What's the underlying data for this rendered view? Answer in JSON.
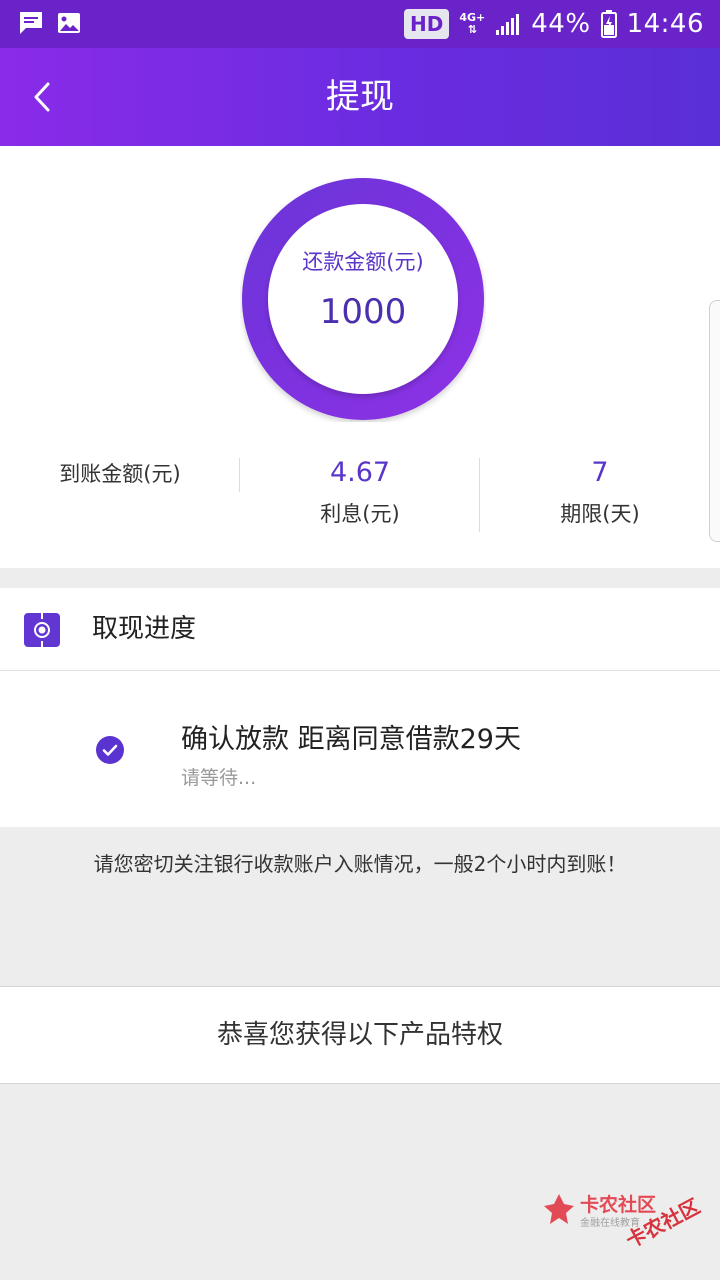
{
  "status_bar": {
    "hd": "HD",
    "network": "4G+",
    "battery": "44%",
    "time": "14:46"
  },
  "header": {
    "title": "提现",
    "back_icon": "chevron-left-icon"
  },
  "summary": {
    "ring_label": "还款金额(元)",
    "ring_value": "1000",
    "stats": [
      {
        "value": "",
        "label": "到账金额(元)"
      },
      {
        "value": "4.67",
        "label": "利息(元)"
      },
      {
        "value": "7",
        "label": "期限(天)"
      }
    ]
  },
  "progress": {
    "title": "取现进度",
    "step_title": "确认放款 距离同意借款29天",
    "step_subtitle": "请等待..."
  },
  "notice": "请您密切关注银行收款账户入账情况，一般2个小时内到账！",
  "perk_banner": "恭喜您获得以下产品特权",
  "watermark": {
    "name": "卡农社区",
    "slogan": "金融在线教育",
    "rotated": "卡农社区"
  },
  "colors": {
    "accent": "#6a2ce0",
    "ring_start": "#8a2be8",
    "ring_end": "#5a2fd6"
  }
}
